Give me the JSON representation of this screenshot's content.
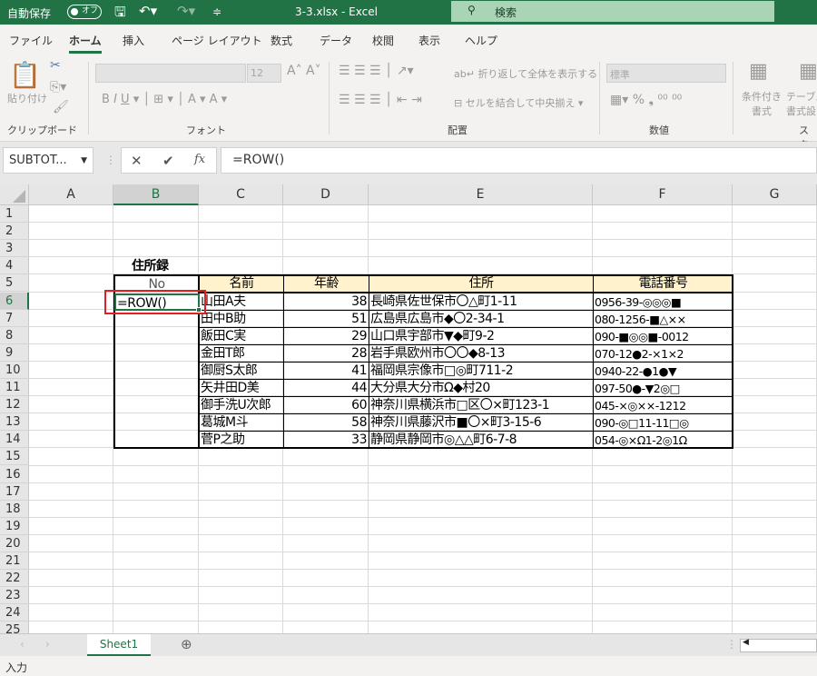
{
  "titlebar": {
    "autosave": "自動保存",
    "toggle": "オフ",
    "filename": "3-3.xlsx  -  Excel",
    "search": "検索"
  },
  "menu": [
    "ファイル",
    "ホーム",
    "挿入",
    "ページ レイアウト",
    "数式",
    "データ",
    "校閲",
    "表示",
    "ヘルプ"
  ],
  "ribbon": {
    "paste": "貼り付け",
    "clipboard": "クリップボード",
    "font": "フォント",
    "font_size": "12",
    "alignment": "配置",
    "wrap": "折り返して全体を表示する",
    "merge": "セルを結合して中央揃え",
    "number_format": "標準",
    "number": "数値",
    "cond_format": "条件付き\n書式",
    "table_format": "テーブル\n書式設",
    "styles": "スタ"
  },
  "formula_bar": {
    "name_box": "SUBTOT...",
    "formula": "=ROW()"
  },
  "columns": [
    "A",
    "B",
    "C",
    "D",
    "E",
    "F",
    "G"
  ],
  "rows": [
    "1",
    "2",
    "3",
    "4",
    "5",
    "6",
    "7",
    "8",
    "9",
    "10",
    "11",
    "12",
    "13",
    "14",
    "15",
    "16",
    "17",
    "18",
    "19",
    "20",
    "21",
    "22",
    "23",
    "24",
    "25"
  ],
  "sheet": {
    "title": "住所録",
    "headers": [
      "No",
      "名前",
      "年齢",
      "住所",
      "電話番号"
    ],
    "editing_cell": "=ROW()",
    "records": [
      [
        "山田A夫",
        "38",
        "長崎県佐世保市〇△町1-11",
        "0956-39-◎◎◎■"
      ],
      [
        "田中B助",
        "51",
        "広島県広島市◆〇2-34-1",
        "080-1256-■△××"
      ],
      [
        "飯田C実",
        "29",
        "山口県宇部市▼◆町9-2",
        "090-■◎◎■-0012"
      ],
      [
        "金田T郎",
        "28",
        "岩手県欧州市〇〇◆8-13",
        "070-12●2-×1×2"
      ],
      [
        "御厨S太郎",
        "41",
        "福岡県宗像市□◎町711-2",
        "0940-22-●1●▼"
      ],
      [
        "矢井田D美",
        "44",
        "大分県大分市Ω◆村20",
        "097-50●-▼2◎□"
      ],
      [
        "御手洗U次郎",
        "60",
        "神奈川県横浜市□区〇×町123-1",
        "045-×◎××-1212"
      ],
      [
        "葛城M斗",
        "58",
        "神奈川県藤沢市■〇×町3-15-6",
        "090-◎□11-11□◎"
      ],
      [
        "菅P之助",
        "33",
        "静岡県静岡市◎△△町6-7-8",
        "054-◎×Ω1-2◎1Ω"
      ]
    ]
  },
  "tabs": {
    "sheet1": "Sheet1"
  },
  "status": "入力",
  "colors": {
    "accent": "#217346",
    "header_fill": "#fff2cc",
    "highlight": "#e02020"
  }
}
